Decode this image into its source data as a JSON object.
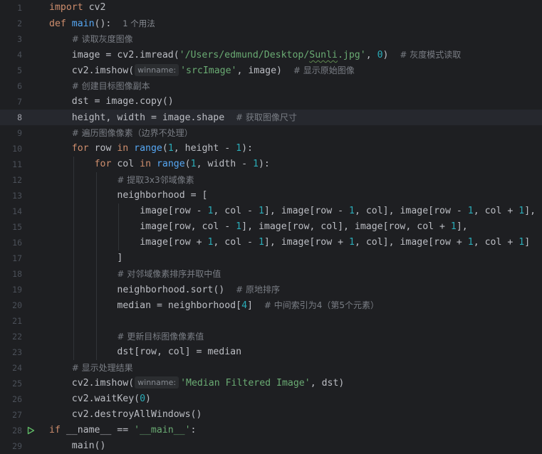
{
  "editor": {
    "current_line": 8,
    "run_line": 28,
    "lines": [
      {
        "n": "1",
        "indent": 0,
        "tokens": [
          [
            "kw",
            "import"
          ],
          [
            "p",
            " cv2"
          ]
        ]
      },
      {
        "n": "2",
        "indent": 0,
        "tokens": [
          [
            "kw",
            "def"
          ],
          [
            "p",
            " "
          ],
          [
            "fn",
            "main"
          ],
          [
            "p",
            "():  "
          ],
          [
            "usage",
            "1 个用法"
          ]
        ]
      },
      {
        "n": "3",
        "indent": 1,
        "tokens": [
          [
            "cmt",
            "# 读取灰度图像"
          ]
        ]
      },
      {
        "n": "4",
        "indent": 1,
        "tokens": [
          [
            "p",
            "image = cv2.imread("
          ],
          [
            "str",
            "'/Users/edmund/Desktop/"
          ],
          [
            "strsq",
            "Sunli"
          ],
          [
            "str",
            ".jpg'"
          ],
          [
            "p",
            ", "
          ],
          [
            "num",
            "0"
          ],
          [
            "p",
            ")  "
          ],
          [
            "cmt",
            "# 灰度模式读取"
          ]
        ]
      },
      {
        "n": "5",
        "indent": 1,
        "tokens": [
          [
            "p",
            "cv2.imshow("
          ],
          [
            "hint",
            "winname:"
          ],
          [
            "str",
            "'srcImage'"
          ],
          [
            "p",
            ", image)  "
          ],
          [
            "cmt",
            "# 显示原始图像"
          ]
        ]
      },
      {
        "n": "6",
        "indent": 1,
        "tokens": [
          [
            "cmt",
            "# 创建目标图像副本"
          ]
        ]
      },
      {
        "n": "7",
        "indent": 1,
        "tokens": [
          [
            "p",
            "dst = image.copy()"
          ]
        ]
      },
      {
        "n": "8",
        "indent": 1,
        "tokens": [
          [
            "p",
            "height, width = image.shape  "
          ],
          [
            "cmt",
            "# 获取图像尺寸"
          ]
        ]
      },
      {
        "n": "9",
        "indent": 1,
        "tokens": [
          [
            "cmt",
            "# 遍历图像像素（边界不处理）"
          ]
        ]
      },
      {
        "n": "10",
        "indent": 1,
        "tokens": [
          [
            "kw",
            "for"
          ],
          [
            "p",
            " row "
          ],
          [
            "kw",
            "in"
          ],
          [
            "p",
            " "
          ],
          [
            "fn",
            "range"
          ],
          [
            "p",
            "("
          ],
          [
            "num",
            "1"
          ],
          [
            "p",
            ", height - "
          ],
          [
            "num",
            "1"
          ],
          [
            "p",
            "):"
          ]
        ]
      },
      {
        "n": "11",
        "indent": 2,
        "tokens": [
          [
            "kw",
            "for"
          ],
          [
            "p",
            " col "
          ],
          [
            "kw",
            "in"
          ],
          [
            "p",
            " "
          ],
          [
            "fn",
            "range"
          ],
          [
            "p",
            "("
          ],
          [
            "num",
            "1"
          ],
          [
            "p",
            ", width - "
          ],
          [
            "num",
            "1"
          ],
          [
            "p",
            "):"
          ]
        ]
      },
      {
        "n": "12",
        "indent": 3,
        "tokens": [
          [
            "cmt",
            "# 提取3x3邻域像素"
          ]
        ]
      },
      {
        "n": "13",
        "indent": 3,
        "tokens": [
          [
            "p",
            "neighborhood = ["
          ]
        ]
      },
      {
        "n": "14",
        "indent": 4,
        "tokens": [
          [
            "p",
            "image[row - "
          ],
          [
            "num",
            "1"
          ],
          [
            "p",
            ", col - "
          ],
          [
            "num",
            "1"
          ],
          [
            "p",
            "], image[row - "
          ],
          [
            "num",
            "1"
          ],
          [
            "p",
            ", col], image[row - "
          ],
          [
            "num",
            "1"
          ],
          [
            "p",
            ", col + "
          ],
          [
            "num",
            "1"
          ],
          [
            "p",
            "],"
          ]
        ]
      },
      {
        "n": "15",
        "indent": 4,
        "tokens": [
          [
            "p",
            "image[row, col - "
          ],
          [
            "num",
            "1"
          ],
          [
            "p",
            "], image[row, col], image[row, col + "
          ],
          [
            "num",
            "1"
          ],
          [
            "p",
            "],"
          ]
        ]
      },
      {
        "n": "16",
        "indent": 4,
        "tokens": [
          [
            "p",
            "image[row + "
          ],
          [
            "num",
            "1"
          ],
          [
            "p",
            ", col - "
          ],
          [
            "num",
            "1"
          ],
          [
            "p",
            "], image[row + "
          ],
          [
            "num",
            "1"
          ],
          [
            "p",
            ", col], image[row + "
          ],
          [
            "num",
            "1"
          ],
          [
            "p",
            ", col + "
          ],
          [
            "num",
            "1"
          ],
          [
            "p",
            "]"
          ]
        ]
      },
      {
        "n": "17",
        "indent": 3,
        "tokens": [
          [
            "p",
            "]"
          ]
        ]
      },
      {
        "n": "18",
        "indent": 3,
        "tokens": [
          [
            "cmt",
            "# 对邻域像素排序并取中值"
          ]
        ]
      },
      {
        "n": "19",
        "indent": 3,
        "tokens": [
          [
            "p",
            "neighborhood.sort()  "
          ],
          [
            "cmt",
            "# 原地排序"
          ]
        ]
      },
      {
        "n": "20",
        "indent": 3,
        "tokens": [
          [
            "p",
            "median = neighborhood["
          ],
          [
            "num",
            "4"
          ],
          [
            "p",
            "]  "
          ],
          [
            "cmt",
            "# 中间索引为4（第5个元素）"
          ]
        ]
      },
      {
        "n": "21",
        "indent": 3,
        "tokens": []
      },
      {
        "n": "22",
        "indent": 3,
        "tokens": [
          [
            "cmt",
            "# 更新目标图像像素值"
          ]
        ]
      },
      {
        "n": "23",
        "indent": 3,
        "tokens": [
          [
            "p",
            "dst[row, col] = median"
          ]
        ]
      },
      {
        "n": "24",
        "indent": 1,
        "tokens": [
          [
            "cmt",
            "# 显示处理结果"
          ]
        ]
      },
      {
        "n": "25",
        "indent": 1,
        "tokens": [
          [
            "p",
            "cv2.imshow("
          ],
          [
            "hint",
            "winname:"
          ],
          [
            "str",
            "'Median Filtered Image'"
          ],
          [
            "p",
            ", dst)"
          ]
        ]
      },
      {
        "n": "26",
        "indent": 1,
        "tokens": [
          [
            "p",
            "cv2.waitKey("
          ],
          [
            "num",
            "0"
          ],
          [
            "p",
            ")"
          ]
        ]
      },
      {
        "n": "27",
        "indent": 1,
        "tokens": [
          [
            "p",
            "cv2.destroyAllWindows()"
          ]
        ]
      },
      {
        "n": "28",
        "indent": 0,
        "tokens": [
          [
            "kw",
            "if"
          ],
          [
            "p",
            " __name__ == "
          ],
          [
            "str",
            "'__main__'"
          ],
          [
            "p",
            ":"
          ]
        ]
      },
      {
        "n": "29",
        "indent": 1,
        "tokens": [
          [
            "p",
            "main()"
          ]
        ]
      }
    ]
  }
}
